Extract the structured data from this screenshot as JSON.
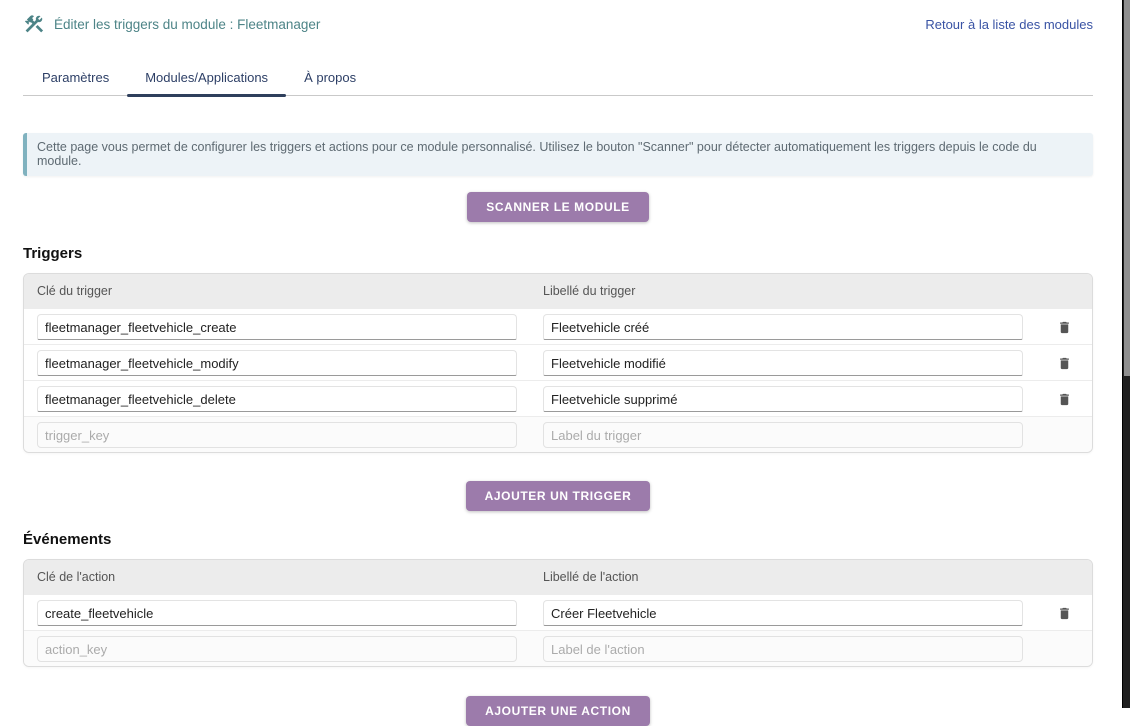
{
  "header": {
    "title": "Éditer les triggers du module : Fleetmanager",
    "icon": "tools-icon",
    "back_link": "Retour à la liste des modules"
  },
  "tabs": [
    {
      "label": "Paramètres",
      "active": false
    },
    {
      "label": "Modules/Applications",
      "active": true
    },
    {
      "label": "À propos",
      "active": false
    }
  ],
  "info_message": "Cette page vous permet de configurer les triggers et actions pour ce module personnalisé. Utilisez le bouton \"Scanner\" pour détecter automatiquement les triggers depuis le code du module.",
  "scan_button_label": "SCANNER LE MODULE",
  "triggers": {
    "heading": "Triggers",
    "columns": [
      "Clé du trigger",
      "Libellé du trigger"
    ],
    "rows": [
      {
        "key": "fleetmanager_fleetvehicle_create",
        "label": "Fleetvehicle créé"
      },
      {
        "key": "fleetmanager_fleetvehicle_modify",
        "label": "Fleetvehicle modifié"
      },
      {
        "key": "fleetmanager_fleetvehicle_delete",
        "label": "Fleetvehicle supprimé"
      }
    ],
    "placeholder": {
      "key": "trigger_key",
      "label": "Label du trigger"
    },
    "add_button_label": "AJOUTER UN TRIGGER",
    "delete_icon": "trash-icon"
  },
  "events": {
    "heading": "Événements",
    "columns": [
      "Clé de l'action",
      "Libellé de l'action"
    ],
    "rows": [
      {
        "key": "create_fleetvehicle",
        "label": "Créer Fleetvehicle"
      }
    ],
    "placeholder": {
      "key": "action_key",
      "label": "Label de l'action"
    },
    "add_button_label": "AJOUTER UNE ACTION",
    "delete_icon": "trash-icon"
  },
  "colors": {
    "accent_purple": "#9c7bab",
    "title_teal": "#4d8487",
    "tab_navy": "#2d3f66",
    "active_tab_underline": "#2e3f5c",
    "link_blue": "#3953a4",
    "info_background": "#edf3f7",
    "info_left_border": "#80b2bf",
    "table_header_background": "#ececec",
    "scrollbar_track": "#202020",
    "scrollbar_thumb": "#8f8f8f"
  },
  "scrollbar": {
    "thumb_position": "top"
  }
}
